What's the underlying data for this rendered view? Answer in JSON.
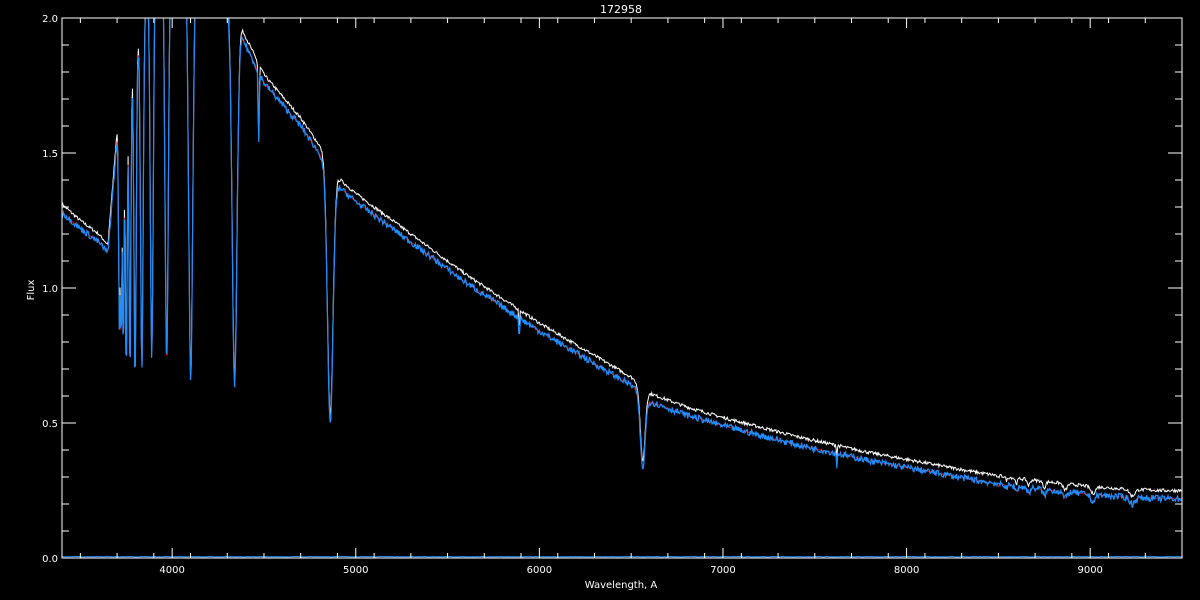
{
  "chart_data": {
    "type": "line",
    "title": "172958",
    "xlabel": "Wavelength, A",
    "ylabel": "Flux",
    "xlim": [
      3400,
      9500
    ],
    "ylim": [
      0.0,
      2.0
    ],
    "x_ticks": [
      4000,
      5000,
      6000,
      7000,
      8000,
      9000
    ],
    "x_tick_labels": [
      "4000",
      "5000",
      "6000",
      "7000",
      "8000",
      "9000"
    ],
    "y_ticks": [
      0.0,
      0.5,
      1.0,
      1.5,
      2.0
    ],
    "y_tick_labels": [
      "0.0",
      "0.5",
      "1.0",
      "1.5",
      "2.0"
    ],
    "grid": false,
    "background": "#000000",
    "axis_color": "#ffffff",
    "continuum": [
      [
        3400,
        1.28
      ],
      [
        3500,
        1.22
      ],
      [
        3600,
        1.17
      ],
      [
        3650,
        1.13
      ],
      [
        3700,
        1.55
      ],
      [
        3800,
        1.85
      ],
      [
        3900,
        2.2
      ],
      [
        4000,
        2.25
      ],
      [
        4200,
        2.15
      ],
      [
        4300,
        2.05
      ],
      [
        4400,
        1.9
      ],
      [
        4500,
        1.76
      ],
      [
        4600,
        1.68
      ],
      [
        4700,
        1.6
      ],
      [
        4800,
        1.5
      ],
      [
        4900,
        1.38
      ],
      [
        5000,
        1.32
      ],
      [
        5200,
        1.22
      ],
      [
        5400,
        1.12
      ],
      [
        5600,
        1.02
      ],
      [
        5800,
        0.93
      ],
      [
        6000,
        0.84
      ],
      [
        6200,
        0.76
      ],
      [
        6400,
        0.68
      ],
      [
        6500,
        0.64
      ],
      [
        6600,
        0.58
      ],
      [
        6800,
        0.53
      ],
      [
        7000,
        0.49
      ],
      [
        7200,
        0.455
      ],
      [
        7400,
        0.42
      ],
      [
        7600,
        0.39
      ],
      [
        7800,
        0.36
      ],
      [
        8000,
        0.335
      ],
      [
        8200,
        0.31
      ],
      [
        8400,
        0.285
      ],
      [
        8600,
        0.265
      ],
      [
        8800,
        0.25
      ],
      [
        9000,
        0.235
      ],
      [
        9200,
        0.225
      ],
      [
        9400,
        0.22
      ],
      [
        9500,
        0.22
      ]
    ],
    "absorption_lines": [
      {
        "x": 3712,
        "depth": 0.45,
        "width": 8
      },
      {
        "x": 3722,
        "depth": 0.5,
        "width": 8
      },
      {
        "x": 3734,
        "depth": 0.55,
        "width": 8
      },
      {
        "x": 3750,
        "depth": 0.6,
        "width": 10
      },
      {
        "x": 3770,
        "depth": 0.62,
        "width": 10
      },
      {
        "x": 3798,
        "depth": 0.65,
        "width": 12
      },
      {
        "x": 3835,
        "depth": 0.65,
        "width": 14
      },
      {
        "x": 3889,
        "depth": 0.66,
        "width": 16
      },
      {
        "x": 3970,
        "depth": 0.68,
        "width": 18
      },
      {
        "x": 4101,
        "depth": 0.7,
        "width": 22
      },
      {
        "x": 4340,
        "depth": 0.68,
        "width": 26
      },
      {
        "x": 4471,
        "depth": 0.15,
        "width": 6
      },
      {
        "x": 4861,
        "depth": 0.65,
        "width": 30
      },
      {
        "x": 5890,
        "depth": 0.08,
        "width": 5
      },
      {
        "x": 6563,
        "depth": 0.45,
        "width": 26
      },
      {
        "x": 7620,
        "depth": 0.12,
        "width": 4
      },
      {
        "x": 8498,
        "depth": 0.04,
        "width": 8
      },
      {
        "x": 8545,
        "depth": 0.05,
        "width": 10
      },
      {
        "x": 8598,
        "depth": 0.07,
        "width": 12
      },
      {
        "x": 8665,
        "depth": 0.08,
        "width": 14
      },
      {
        "x": 8750,
        "depth": 0.09,
        "width": 16
      },
      {
        "x": 8863,
        "depth": 0.1,
        "width": 20
      },
      {
        "x": 9015,
        "depth": 0.11,
        "width": 24
      },
      {
        "x": 9229,
        "depth": 0.11,
        "width": 28
      }
    ],
    "series": [
      {
        "color": "#ffffff",
        "offset": 0.03,
        "noise": 0.006
      },
      {
        "color": "#cc0000",
        "offset": 0.0,
        "noise": 0.0
      },
      {
        "color": "#1e8fff",
        "offset": 0.0,
        "noise": 0.012
      }
    ],
    "error_series": {
      "color": "#1e8fff",
      "value": 0.005
    }
  }
}
